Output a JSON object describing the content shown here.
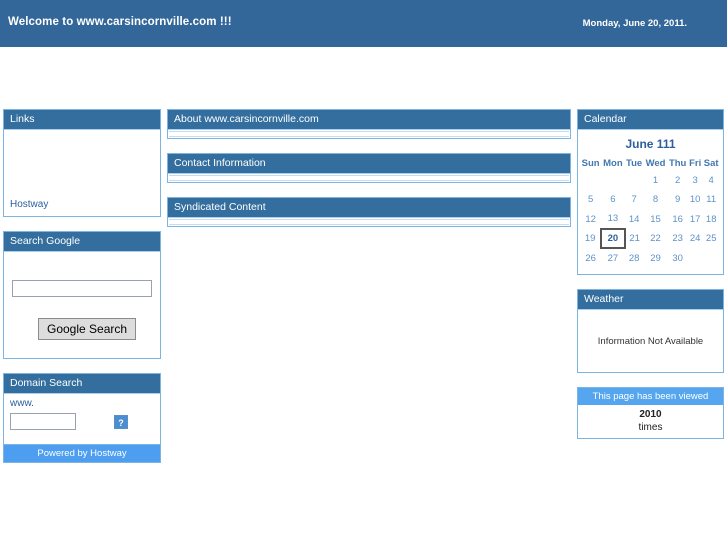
{
  "banner": {
    "title": "Welcome to www.carsincornville.com !!!",
    "date": "Monday, June 20, 2011."
  },
  "left_column": {
    "links_panel": {
      "title": "Links",
      "link_label": "Hostway"
    },
    "search_google_panel": {
      "title": "Search Google",
      "input_value": "",
      "input_placeholder": "",
      "button_label": "Google Search"
    },
    "domain_search_panel": {
      "title": "Domain Search",
      "prefix_label": "www.",
      "input_value": "",
      "input_placeholder": "",
      "go_icon_label": "?",
      "footer_label": "Powered by Hostway"
    }
  },
  "center_column": {
    "panels": [
      {
        "title": "About www.carsincornville.com"
      },
      {
        "title": "Contact Information"
      },
      {
        "title": "Syndicated Content"
      }
    ]
  },
  "right_column": {
    "calendar_panel": {
      "title": "Calendar",
      "month_title": "June 111",
      "day_headers": [
        "Sun",
        "Mon",
        "Tue",
        "Wed",
        "Thu",
        "Fri",
        "Sat"
      ],
      "weeks": [
        [
          "",
          "",
          "",
          "1",
          "2",
          "3",
          "4"
        ],
        [
          "5",
          "6",
          "7",
          "8",
          "9",
          "10",
          "11"
        ],
        [
          "12",
          "13",
          "14",
          "15",
          "16",
          "17",
          "18"
        ],
        [
          "19",
          "20",
          "21",
          "22",
          "23",
          "24",
          "25"
        ],
        [
          "26",
          "27",
          "28",
          "29",
          "30",
          "",
          ""
        ]
      ],
      "today": "20"
    },
    "weather_panel": {
      "title": "Weather",
      "message": "Information Not Available"
    },
    "counter_panel": {
      "title": "This page has been viewed",
      "count": "2010",
      "unit": "times"
    }
  },
  "colors": {
    "banner_blue": "#336699",
    "portlet_head_blue": "#336e9e",
    "portlet_border_blue": "#7db4e0",
    "accent_light_blue": "#4d9ef0",
    "link_blue": "#2c5f9e"
  }
}
